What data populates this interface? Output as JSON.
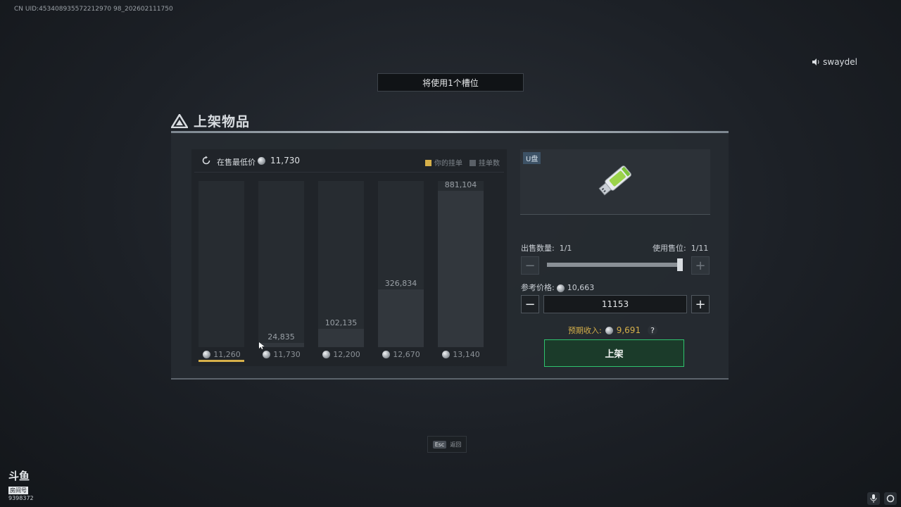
{
  "header": {
    "uid": "CN UID:453408935572212970 98_202602111750",
    "username": "swaydel"
  },
  "slot_banner": "将使用1个槽位",
  "title": "上架物品",
  "chart_header": {
    "lowest_label": "在售最低价",
    "lowest_value": "11,730",
    "legend_mine": "你的挂单",
    "legend_count": "挂单数"
  },
  "chart_data": {
    "type": "bar",
    "categories": [
      "11,260",
      "11,730",
      "12,200",
      "12,670",
      "13,140"
    ],
    "values": [
      0,
      24835,
      102135,
      326834,
      881104
    ],
    "value_labels": [
      "",
      "24,835",
      "102,135",
      "326,834",
      "881,104"
    ],
    "ylim": [
      0,
      881104
    ],
    "highlight_index": 0
  },
  "item": {
    "tag": "U盘",
    "icon": "usb-drive-icon"
  },
  "sell": {
    "qty_label": "出售数量:",
    "qty_value": "1/1",
    "slot_label": "使用售位:",
    "slot_value": "1/11",
    "qty_fraction": 1.0
  },
  "price": {
    "ref_label": "参考价格:",
    "ref_value": "10,663",
    "input_value": "11153"
  },
  "income": {
    "label": "预期收入:",
    "value": "9,691",
    "help": "?"
  },
  "list_button": "上架",
  "esc": {
    "key": "Esc",
    "label": "返回"
  },
  "watermark": {
    "main": "斗鱼",
    "sub": "房间号",
    "room": "9398372"
  },
  "colors": {
    "accent_gold": "#d6b04a",
    "accent_green": "#2fc36e"
  }
}
